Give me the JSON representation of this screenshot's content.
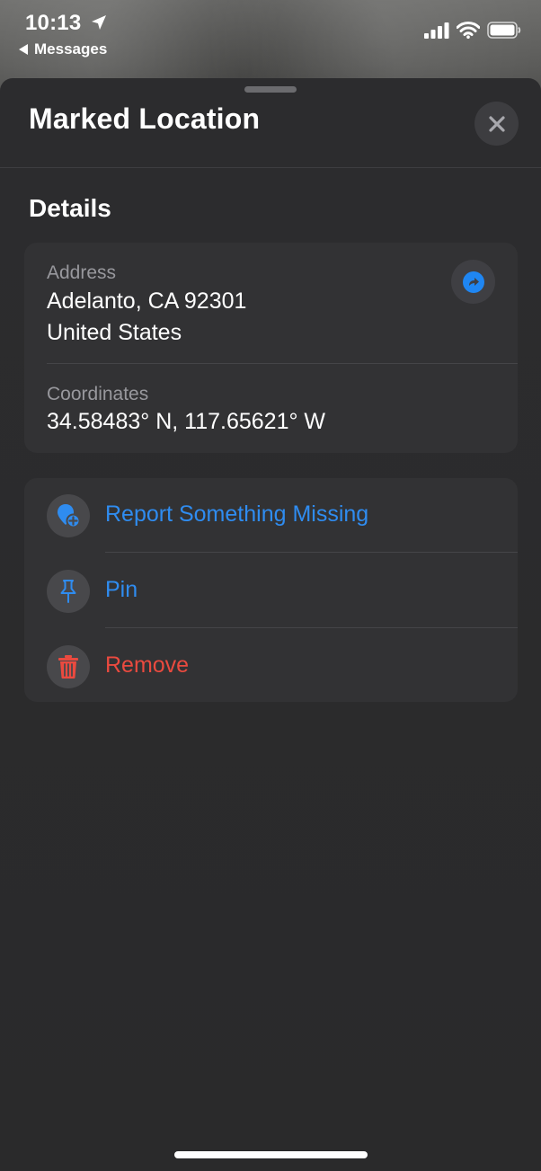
{
  "status_bar": {
    "time": "10:13",
    "back_label": "Messages",
    "icons": [
      "location-arrow-icon",
      "cellular-signal-icon",
      "wifi-icon",
      "battery-icon"
    ]
  },
  "sheet": {
    "title": "Marked Location",
    "close_icon": "close-icon",
    "section_title": "Details",
    "address": {
      "label": "Address",
      "line1": "Adelanto, CA  92301",
      "line2": "United States",
      "share_icon": "share-arrow-icon"
    },
    "coordinates": {
      "label": "Coordinates",
      "value": "34.58483° N, 117.65621° W"
    },
    "actions": [
      {
        "label": "Report Something Missing",
        "icon": "report-location-plus-icon",
        "color": "#2f8cf0"
      },
      {
        "label": "Pin",
        "icon": "pushpin-icon",
        "color": "#2f8cf0"
      },
      {
        "label": "Remove",
        "icon": "trash-icon",
        "color": "#ea4a3f"
      }
    ]
  },
  "colors": {
    "accent": "#2f8cf0",
    "destructive": "#ea4a3f",
    "sheet_background": "#2c2c2e",
    "card_background": "#323234",
    "secondary_text": "#98989d"
  }
}
